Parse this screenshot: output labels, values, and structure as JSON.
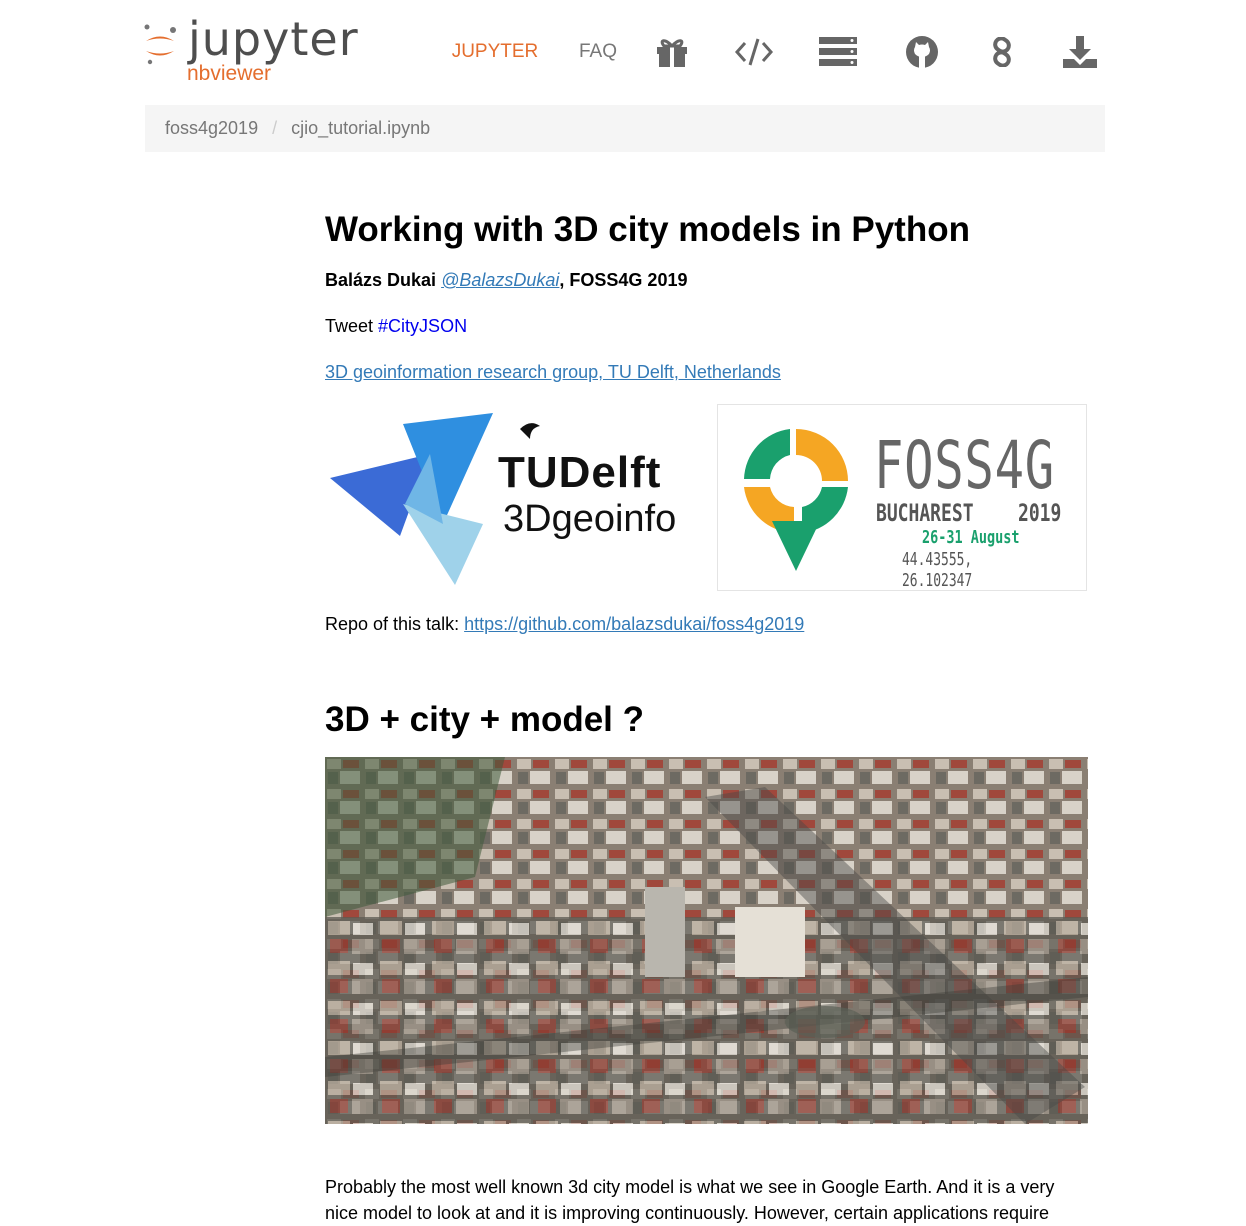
{
  "brand": {
    "name": "jupyter",
    "sub": "nbviewer"
  },
  "nav": {
    "jupyter": "JUPYTER",
    "faq": "FAQ",
    "icons": [
      "gift-icon",
      "code-icon",
      "server-icon",
      "github-icon",
      "link-icon",
      "download-icon"
    ]
  },
  "breadcrumb": {
    "parent": "foss4g2019",
    "separator": "/",
    "current": "cjio_tutorial.ipynb"
  },
  "notebook": {
    "title": "Working with 3D city models in Python",
    "author_name": "Balázs Dukai",
    "author_handle": "@BalazsDukai",
    "author_event": ", FOSS4G 2019",
    "tweet_label": "Tweet",
    "tweet_hashtag": "#CityJSON",
    "group_link": "3D geoinformation research group, TU Delft, Netherlands",
    "logo_tu": {
      "line1": "TUDelft",
      "line2": "3Dgeoinfo"
    },
    "logo_foss": {
      "title": "FOSS4G",
      "city": "BUCHAREST",
      "year": "2019",
      "dates": "26-31 August",
      "coords": "44.43555, 26.102347"
    },
    "repo_label": "Repo of this talk:",
    "repo_link": "https://github.com/balazsdukai/foss4g2019",
    "section_title": "3D + city + model ?",
    "paragraph": "Probably the most well known 3d city model is what we see in Google Earth. And it is a very nice model to look at and it is improving continuously. However, certain applications require"
  },
  "colors": {
    "accent": "#e46e2e",
    "link": "#337ab7",
    "hashtag": "#0000ee",
    "foss_green": "#1aa06d",
    "foss_orange": "#f5a623"
  }
}
